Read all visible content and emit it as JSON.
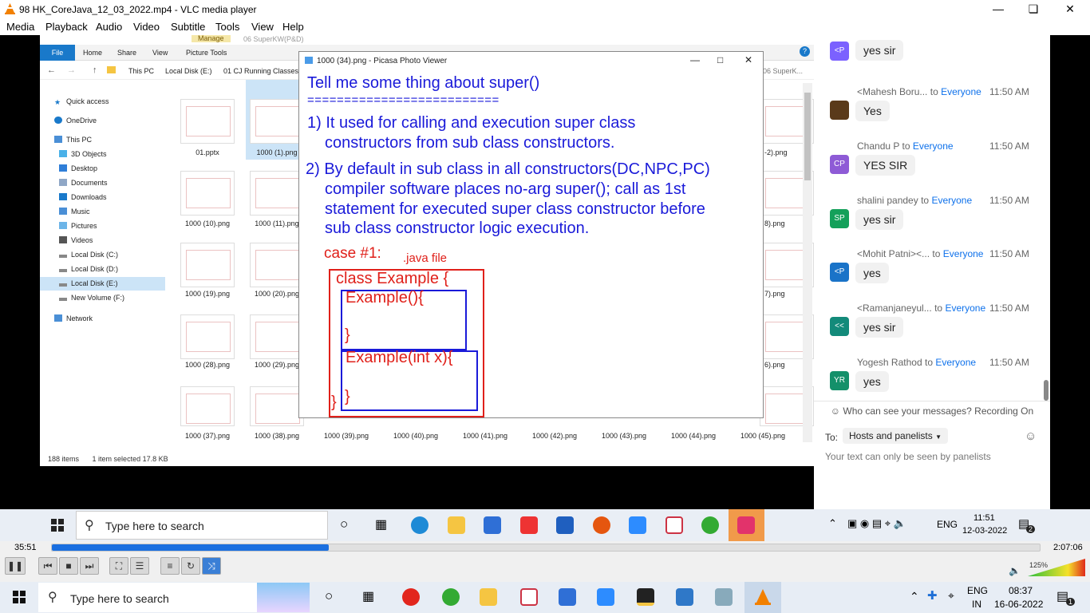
{
  "vlc": {
    "title": "98 HK_CoreJava_12_03_2022.mp4 - VLC media player",
    "menu": [
      "Media",
      "Playback",
      "Audio",
      "Video",
      "Subtitle",
      "Tools",
      "View",
      "Help"
    ],
    "elapsed": "35:51",
    "total": "2:07:06",
    "progress_fraction": 0.28,
    "volume": "125%"
  },
  "explorer": {
    "manage": "Manage",
    "crumb_title": "06 SuperKW(P&D)",
    "tabs": [
      "File",
      "Home",
      "Share",
      "View",
      "Picture Tools"
    ],
    "address": [
      "This PC",
      "Local Disk (E:)",
      "01 CJ Running Classes S"
    ],
    "address_right": "06 SuperK...",
    "nav": [
      "Quick access",
      "OneDrive",
      "This PC",
      "3D Objects",
      "Desktop",
      "Documents",
      "Downloads",
      "Music",
      "Pictures",
      "Videos",
      "Local Disk (C:)",
      "Local Disk (D:)",
      "Local Disk (E:)",
      "New Volume (F:)",
      "Network"
    ],
    "files_row1": [
      "01.pptx",
      "1000 (1).png"
    ],
    "files_row2": [
      "1000 (10).png",
      "1000 (11).png"
    ],
    "files_row3": [
      "1000 (19).png",
      "1000 (20).png"
    ],
    "files_row4": [
      "1000 (28).png",
      "1000 (29).png"
    ],
    "files_bottom": [
      "1000 (37).png",
      "1000 (38).png",
      "1000 (39).png",
      "1000 (40).png",
      "1000 (41).png",
      "1000 (42).png",
      "1000 (43).png",
      "1000 (44).png",
      "1000 (45).png"
    ],
    "right_labels": [
      "-2).png",
      "8).png",
      "7).png",
      "6).png"
    ],
    "status_items": "188 items",
    "status_selected": "1 item selected  17.8 KB"
  },
  "picasa": {
    "title": "1000 (34).png - Picasa Photo Viewer",
    "slide": {
      "heading": "Tell me some thing about super()",
      "rule": "==========================",
      "p1a": "1) It used for calling and execution super class",
      "p1b": "constructors from sub class constructors.",
      "p2a": "2) By default in sub class in all constructors(DC,NPC,PC)",
      "p2b": "compiler software places no-arg super(); call as 1st",
      "p2c": "statement for executed super class constructor before",
      "p2d": "sub class constructor logic execution.",
      "case": "case #1:",
      "file": ".java file",
      "c1": "class Example {",
      "c2": "Example(){",
      "c3": "}",
      "c4": "Example(int x){",
      "c5": "}",
      "c6": "}"
    }
  },
  "chat": {
    "messages": [
      {
        "initials": "<P",
        "color": "#7b61ff",
        "sender": "",
        "to": "",
        "time": "",
        "text": "yes sir"
      },
      {
        "initials": "",
        "color": "#5a3a1a",
        "sender": "<Mahesh Boru...",
        "to": "Everyone",
        "time": "11:50 AM",
        "text": "Yes"
      },
      {
        "initials": "CP",
        "color": "#8e5bd6",
        "sender": "Chandu P",
        "to": "Everyone",
        "time": "11:50 AM",
        "text": "YES SIR"
      },
      {
        "initials": "SP",
        "color": "#14a05a",
        "sender": "shalini pandey",
        "to": "Everyone",
        "time": "11:50 AM",
        "text": "yes sir"
      },
      {
        "initials": "<P",
        "color": "#1a73c8",
        "sender": "<Mohit Patni><...",
        "to": "Everyone",
        "time": "11:50 AM",
        "text": "yes"
      },
      {
        "initials": "<<",
        "color": "#138a7a",
        "sender": "<Ramanjaneyul...",
        "to": "Everyone",
        "time": "11:50 AM",
        "text": "yes sir"
      },
      {
        "initials": "YR",
        "color": "#14906a",
        "sender": "Yogesh Rathod",
        "to": "Everyone",
        "time": "11:50 AM",
        "text": "yes"
      }
    ],
    "to_word": "to",
    "privacy": "Who can see your messages? Recording On",
    "to_label": "To:",
    "recipient": "Hosts and panelists",
    "input_placeholder": "Your text can only be seen by panelists"
  },
  "inner_taskbar": {
    "search": "Type here to search",
    "lang": "ENG",
    "time": "11:51",
    "date": "12-03-2022",
    "notif": "2"
  },
  "outer_taskbar": {
    "search": "Type here to search",
    "lang": "ENG",
    "region": "IN",
    "time": "08:37",
    "date": "16-06-2022",
    "notif": "1"
  },
  "colors": {
    "accent": "#0e71eb",
    "slide_blue": "#1a1ad9",
    "slide_red": "#e0201a",
    "vlc_progress": "#1a6fe0"
  }
}
